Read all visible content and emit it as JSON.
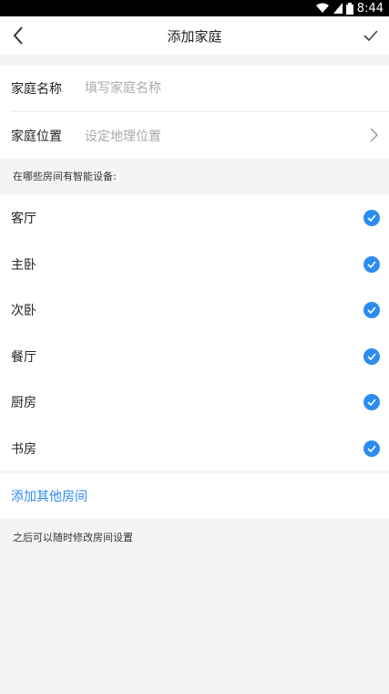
{
  "status_bar": {
    "time": "8:44",
    "icons": [
      "wifi-icon",
      "signal-icon",
      "battery-icon"
    ]
  },
  "nav": {
    "title": "添加家庭",
    "back_icon": "chevron-left-icon",
    "confirm_icon": "check-icon"
  },
  "form": {
    "name_label": "家庭名称",
    "name_placeholder": "填写家庭名称",
    "location_label": "家庭位置",
    "location_placeholder": "设定地理位置"
  },
  "rooms_section": {
    "label": "在哪些房间有智能设备:",
    "rooms": [
      {
        "name": "客厅",
        "checked": true
      },
      {
        "name": "主卧",
        "checked": true
      },
      {
        "name": "次卧",
        "checked": true
      },
      {
        "name": "餐厅",
        "checked": true
      },
      {
        "name": "厨房",
        "checked": true
      },
      {
        "name": "书房",
        "checked": true
      }
    ],
    "add_other": "添加其他房间"
  },
  "footer_note": "之后可以随时修改房间设置",
  "colors": {
    "accent": "#2d8cf0",
    "background": "#f4f4f4"
  }
}
